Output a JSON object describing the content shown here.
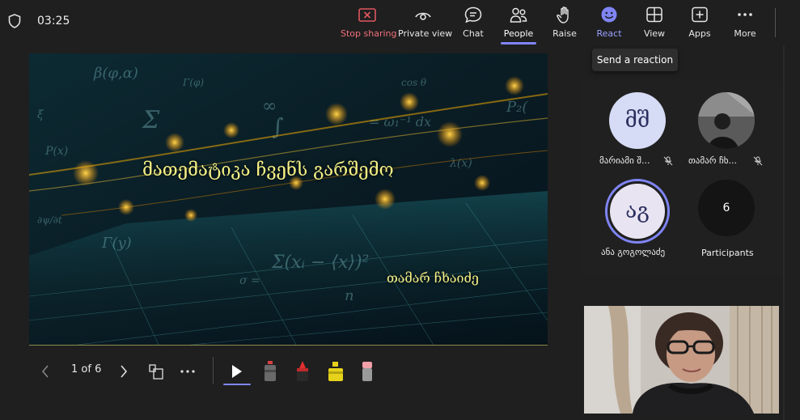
{
  "clock": "03:25",
  "toolbar": {
    "stop_sharing": "Stop sharing",
    "private_view": "Private view",
    "chat": "Chat",
    "people": "People",
    "raise": "Raise",
    "react": "React",
    "view": "View",
    "apps": "Apps",
    "more": "More"
  },
  "tooltip": "Send a reaction",
  "slide": {
    "title": "მათემატიკა ჩვენს გარშემო",
    "author": "თამარ ჩხაიძე"
  },
  "controls": {
    "counter": "1 of 6"
  },
  "participants": {
    "p1": {
      "initials": "მშ",
      "name": "მარიამი შ..."
    },
    "p2": {
      "name": "თამარ ჩხ..."
    },
    "p3": {
      "initials": "აგ",
      "name": "ანა გოგოლაძე"
    },
    "count": {
      "value": "6",
      "label": "Participants"
    }
  },
  "colors": {
    "accent": "#7f85f5",
    "stop_red": "#f1707a",
    "slide_text": "#f4f085",
    "background": "#1f1f1f"
  },
  "icons": [
    "shield-icon",
    "stop-sharing-icon",
    "eye-icon",
    "chat-icon",
    "people-icon",
    "hand-icon",
    "smiley-icon",
    "grid-icon",
    "apps-plus-icon",
    "more-icon",
    "chevron-left-icon",
    "chevron-right-icon",
    "slides-icon",
    "pointer-icon",
    "pen-icon",
    "marker-icon",
    "highlighter-icon",
    "eraser-icon",
    "mic-off-icon"
  ]
}
